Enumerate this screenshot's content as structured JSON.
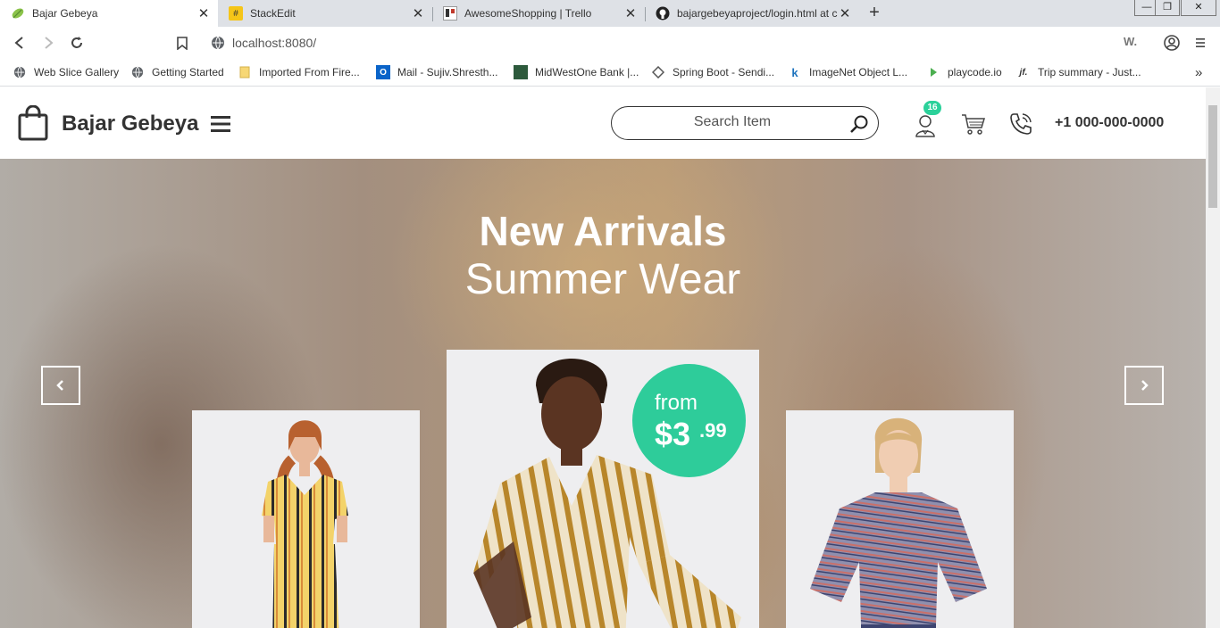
{
  "browser": {
    "tabs": [
      {
        "title": "Bajar Gebeya",
        "icon": "leaf-icon",
        "active": true
      },
      {
        "title": "StackEdit",
        "icon": "stackedit-icon",
        "active": false
      },
      {
        "title": "AwesomeShopping | Trello",
        "icon": "trello-icon",
        "active": false
      },
      {
        "title": "bajargebeyaproject/login.html at c",
        "icon": "github-icon",
        "active": false
      }
    ],
    "new_tab": "+",
    "window_controls": {
      "minimize": "—",
      "restore": "❐",
      "close": "✕"
    },
    "url": "localhost:8080/",
    "extension_label": "W.",
    "bookmarks": [
      {
        "label": "Web Slice Gallery",
        "icon": "globe-icon"
      },
      {
        "label": "Getting Started",
        "icon": "globe-icon"
      },
      {
        "label": "Imported From Fire...",
        "icon": "folder-icon"
      },
      {
        "label": "Mail - Sujiv.Shresth...",
        "icon": "outlook-icon"
      },
      {
        "label": "MidWestOne Bank |...",
        "icon": "bank-icon"
      },
      {
        "label": "Spring Boot - Sendi...",
        "icon": "diamond-icon"
      },
      {
        "label": "ImageNet Object L...",
        "icon": "k-icon"
      },
      {
        "label": "playcode.io",
        "icon": "playcode-icon"
      },
      {
        "label": "Trip summary - Just...",
        "icon": "jf-icon"
      }
    ],
    "more_bookmarks": "»"
  },
  "site": {
    "brand": "Bajar Gebeya",
    "search_placeholder": "Search Item",
    "user_badge_count": "16",
    "phone": "+1 000-000-0000"
  },
  "hero": {
    "title": "New Arrivals",
    "subtitle": "Summer Wear",
    "price_from": "from",
    "price_main": "$3",
    "price_cents": ".99"
  },
  "colors": {
    "accent": "#2ecc9a",
    "text_dark": "#333333"
  }
}
